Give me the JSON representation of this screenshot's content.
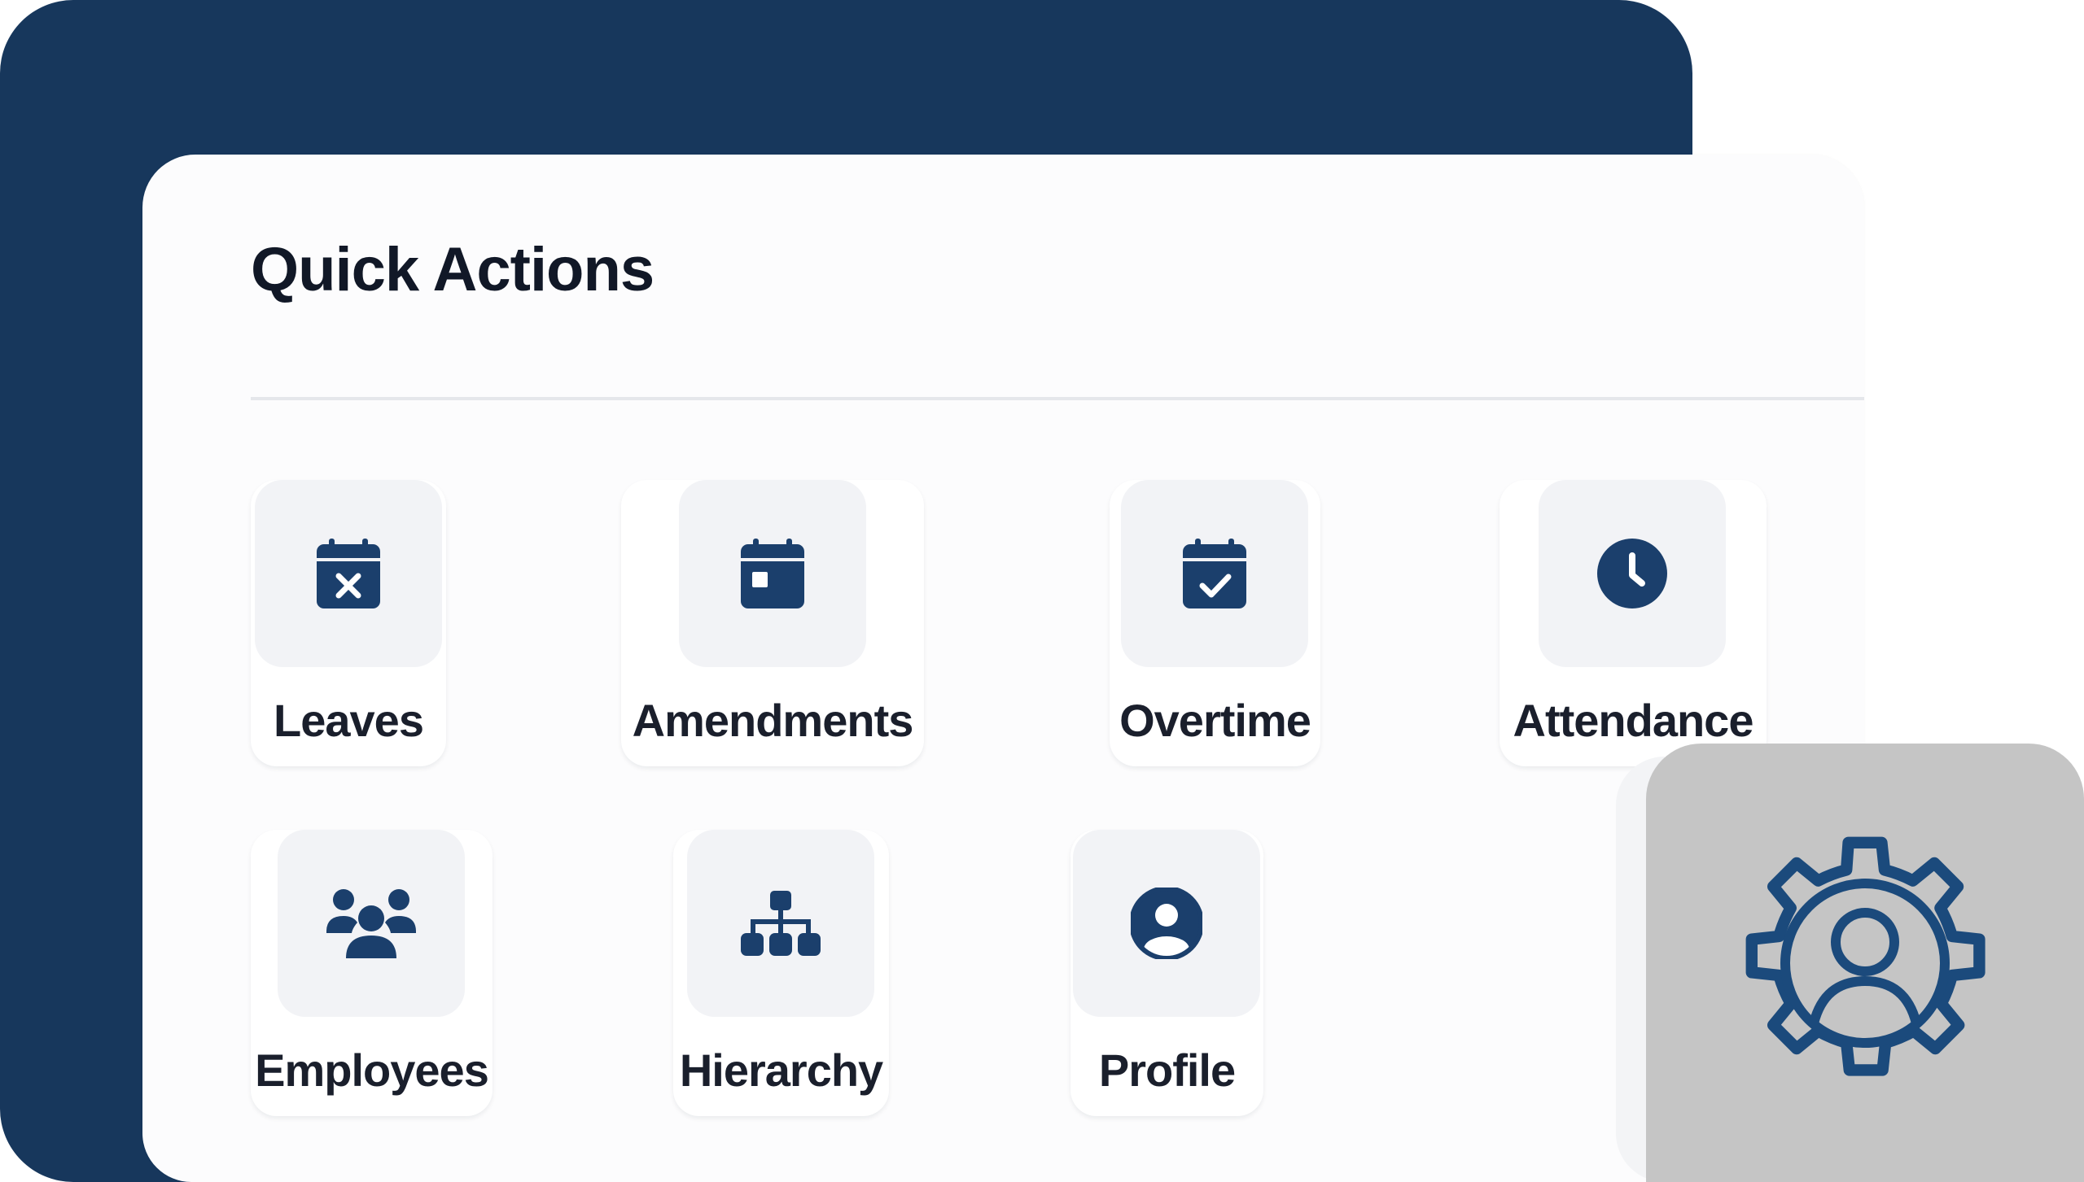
{
  "quick_actions": {
    "title": "Quick Actions",
    "row1": [
      {
        "label": "Leaves",
        "icon": "calendar-x-icon"
      },
      {
        "label": "Amendments",
        "icon": "calendar-icon"
      },
      {
        "label": "Overtime",
        "icon": "calendar-check-icon"
      },
      {
        "label": "Attendance",
        "icon": "clock-icon"
      }
    ],
    "row2": [
      {
        "label": "Employees",
        "icon": "users-icon"
      },
      {
        "label": "Hierarchy",
        "icon": "org-chart-icon"
      },
      {
        "label": "Profile",
        "icon": "user-circle-icon"
      }
    ]
  },
  "settings_badge": {
    "icon": "user-gear-icon"
  },
  "colors": {
    "navy": "#17375c",
    "icon": "#1b3f6c",
    "card": "#fcfcfd",
    "tile_box": "#f2f3f6",
    "gear_panel": "#c5c5c5"
  }
}
